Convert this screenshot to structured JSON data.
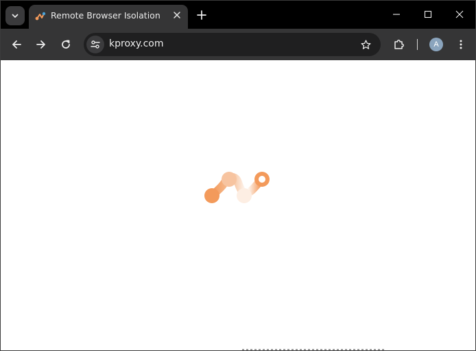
{
  "browser": {
    "tab": {
      "title": "Remote Browser Isolation",
      "favicon": "kproxy-logo-icon"
    },
    "address_bar": {
      "url": "kproxy.com"
    },
    "profile": {
      "initial": "A"
    }
  },
  "page": {
    "loading_logo": "kproxy-logo",
    "accent_colors": [
      "#f39a5b",
      "#f7c4a0",
      "#ffffff"
    ]
  },
  "colors": {
    "titlebar": "#000000",
    "toolbar": "#353536",
    "omnibox": "#1f1f20",
    "content": "#ffffff"
  }
}
